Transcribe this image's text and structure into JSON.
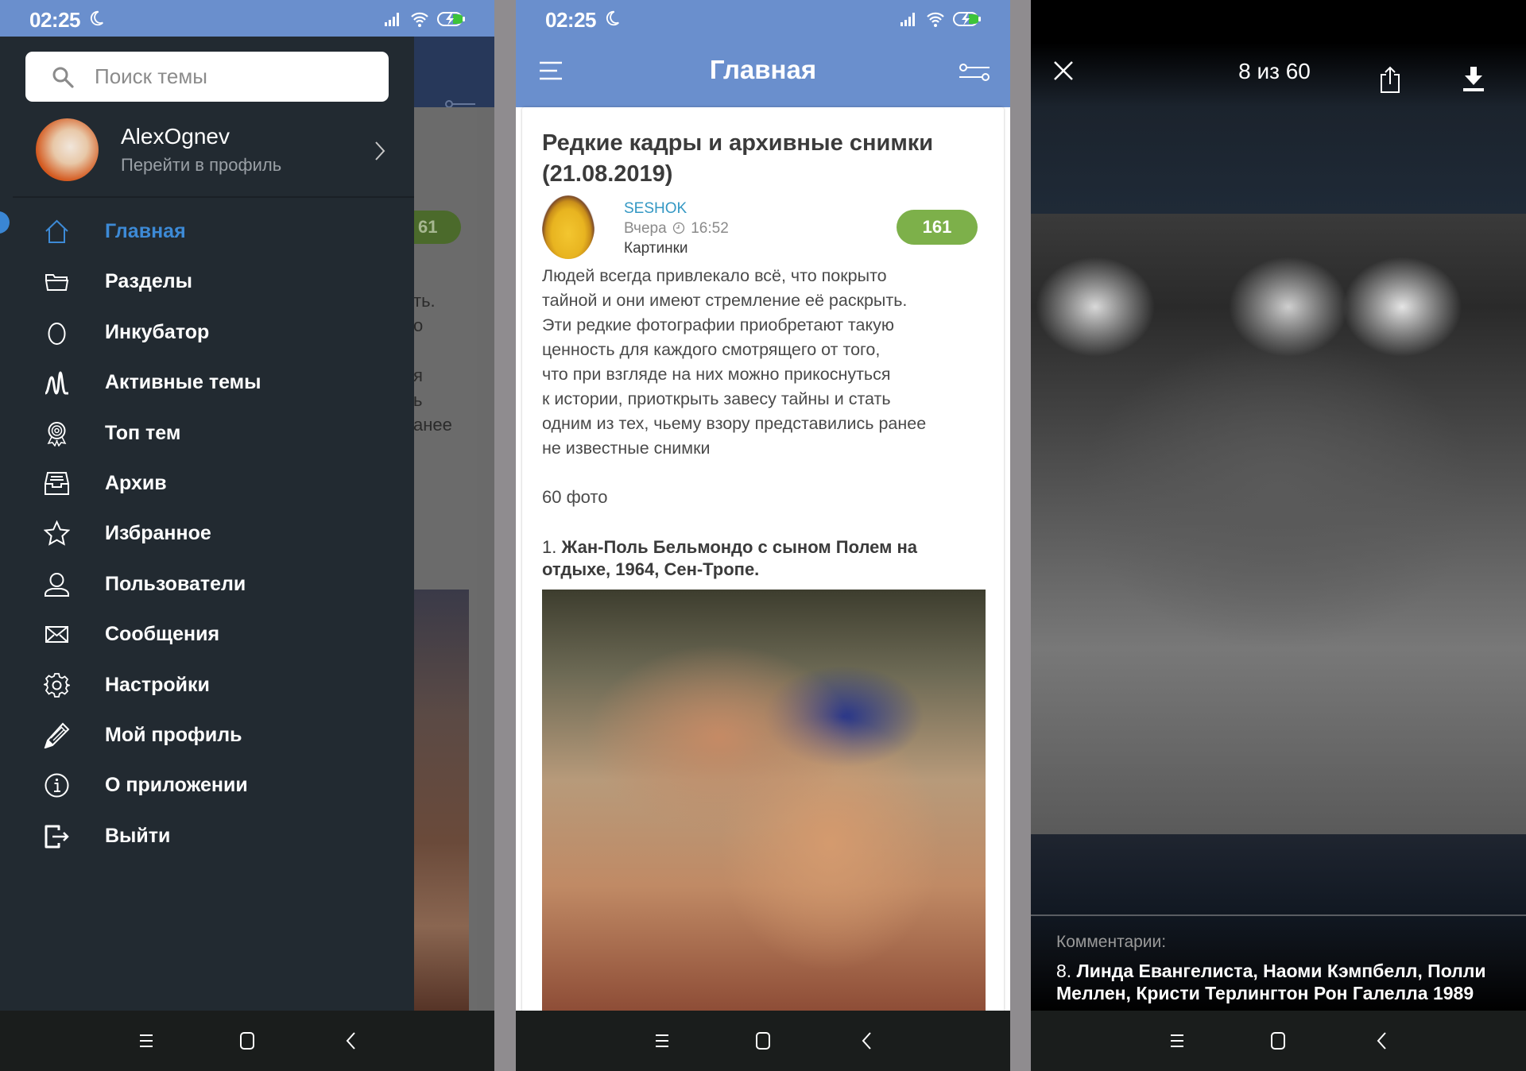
{
  "status_bar": {
    "time": "02:25",
    "battery_color": "#3ec43a"
  },
  "theme": {
    "header_blue": "#6a8fcd",
    "accent_blue": "#3d8ad6",
    "badge_green": "#7db04a",
    "drawer_bg": "#222a31",
    "author_link": "#3498c4"
  },
  "drawer": {
    "search": {
      "placeholder": "Поиск темы"
    },
    "profile": {
      "username": "AlexOgnev",
      "subtitle": "Перейти в профиль"
    },
    "items": [
      {
        "label": "Главная",
        "icon": "home-icon",
        "active": true
      },
      {
        "label": "Разделы",
        "icon": "folder-icon"
      },
      {
        "label": "Инкубатор",
        "icon": "egg-icon"
      },
      {
        "label": "Активные темы",
        "icon": "activity-icon"
      },
      {
        "label": "Топ тем",
        "icon": "award-icon"
      },
      {
        "label": "Архив",
        "icon": "archive-icon"
      },
      {
        "label": "Избранное",
        "icon": "star-icon"
      },
      {
        "label": "Пользователи",
        "icon": "user-icon"
      },
      {
        "label": "Сообщения",
        "icon": "mail-icon"
      },
      {
        "label": "Настройки",
        "icon": "gear-icon"
      },
      {
        "label": "Мой профиль",
        "icon": "pencil-icon"
      },
      {
        "label": "О приложении",
        "icon": "info-icon"
      },
      {
        "label": "Выйти",
        "icon": "logout-icon"
      }
    ],
    "behind": {
      "badge_partial": "61",
      "text_fragments": [
        "ть.",
        "о",
        "я",
        "ь",
        "анее"
      ]
    }
  },
  "feed": {
    "header_title": "Главная",
    "post": {
      "title": "Редкие кадры и архивные снимки (21.08.2019)",
      "author": "SESHOK",
      "date": "Вчера",
      "time": "16:52",
      "category": "Картинки",
      "count": "161",
      "body_lines": "Людей всегда привлекало всё, что покрыто\nтайной и они имеют стремление её раскрыть.\nЭти редкие фотографии приобретают такую\nценность для каждого смотрящего от того,\nчто при взгляде на них можно прикоснуться\nк истории, приоткрыть завесу тайны и стать\nодним из тех, чьему взору представились ранее\nне известные снимки",
      "photo_count": "60 фото",
      "caption_number": "1. ",
      "caption_text": "Жан-Поль Бельмондо с сыном Полем на отдыхе, 1964, Сен-Тропе."
    }
  },
  "viewer": {
    "counter": "8 из 60",
    "current": 8,
    "total": 60,
    "comments_label": "Комментарии:",
    "comment_number": "8. ",
    "comment_text": "Линда Евангелиста, Наоми Кэмпбелл, Полли Меллен, Кристи Терлингтон Рон Галелла 1989"
  }
}
